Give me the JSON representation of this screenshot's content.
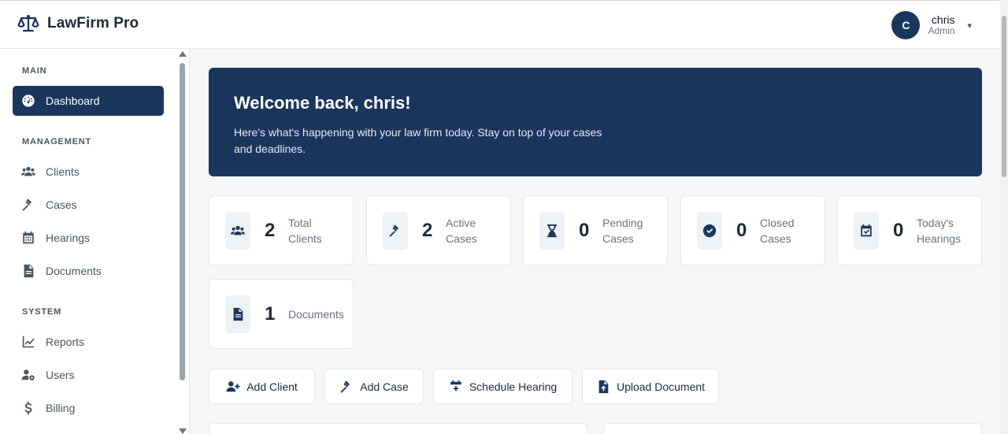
{
  "header": {
    "brand_name": "LawFirm Pro",
    "user_initial": "C",
    "user_name": "chris",
    "user_role": "Admin",
    "caret": "▾"
  },
  "sidebar": {
    "sections": [
      {
        "label": "MAIN"
      },
      {
        "label": "MANAGEMENT"
      },
      {
        "label": "SYSTEM"
      }
    ],
    "items": [
      {
        "label": "Dashboard",
        "icon": "dashboard-icon",
        "active": true
      },
      {
        "label": "Clients",
        "icon": "users-icon"
      },
      {
        "label": "Cases",
        "icon": "gavel-icon"
      },
      {
        "label": "Hearings",
        "icon": "calendar-icon"
      },
      {
        "label": "Documents",
        "icon": "file-icon"
      },
      {
        "label": "Reports",
        "icon": "chart-line-icon"
      },
      {
        "label": "Users",
        "icon": "users-cog-icon"
      },
      {
        "label": "Billing",
        "icon": "dollar-icon"
      }
    ]
  },
  "welcome": {
    "title": "Welcome back, chris!",
    "subtitle": "Here's what's happening with your law firm today. Stay on top of your cases and deadlines."
  },
  "stats": [
    {
      "value": "2",
      "label": "Total Clients",
      "icon": "users-icon"
    },
    {
      "value": "2",
      "label": "Active Cases",
      "icon": "gavel-icon"
    },
    {
      "value": "0",
      "label": "Pending Cases",
      "icon": "hourglass-icon"
    },
    {
      "value": "0",
      "label": "Closed Cases",
      "icon": "check-circle-icon"
    },
    {
      "value": "0",
      "label": "Today's Hearings",
      "icon": "calendar-check-icon"
    },
    {
      "value": "1",
      "label": "Documents",
      "icon": "file-icon"
    }
  ],
  "actions": [
    {
      "label": "Add Client",
      "icon": "user-plus-icon"
    },
    {
      "label": "Add Case",
      "icon": "gavel-icon"
    },
    {
      "label": "Schedule Hearing",
      "icon": "calendar-plus-icon"
    },
    {
      "label": "Upload Document",
      "icon": "file-upload-icon"
    }
  ],
  "colors": {
    "primary": "#1b365d",
    "background": "#f5f6f8",
    "muted_text": "#6b7280"
  }
}
